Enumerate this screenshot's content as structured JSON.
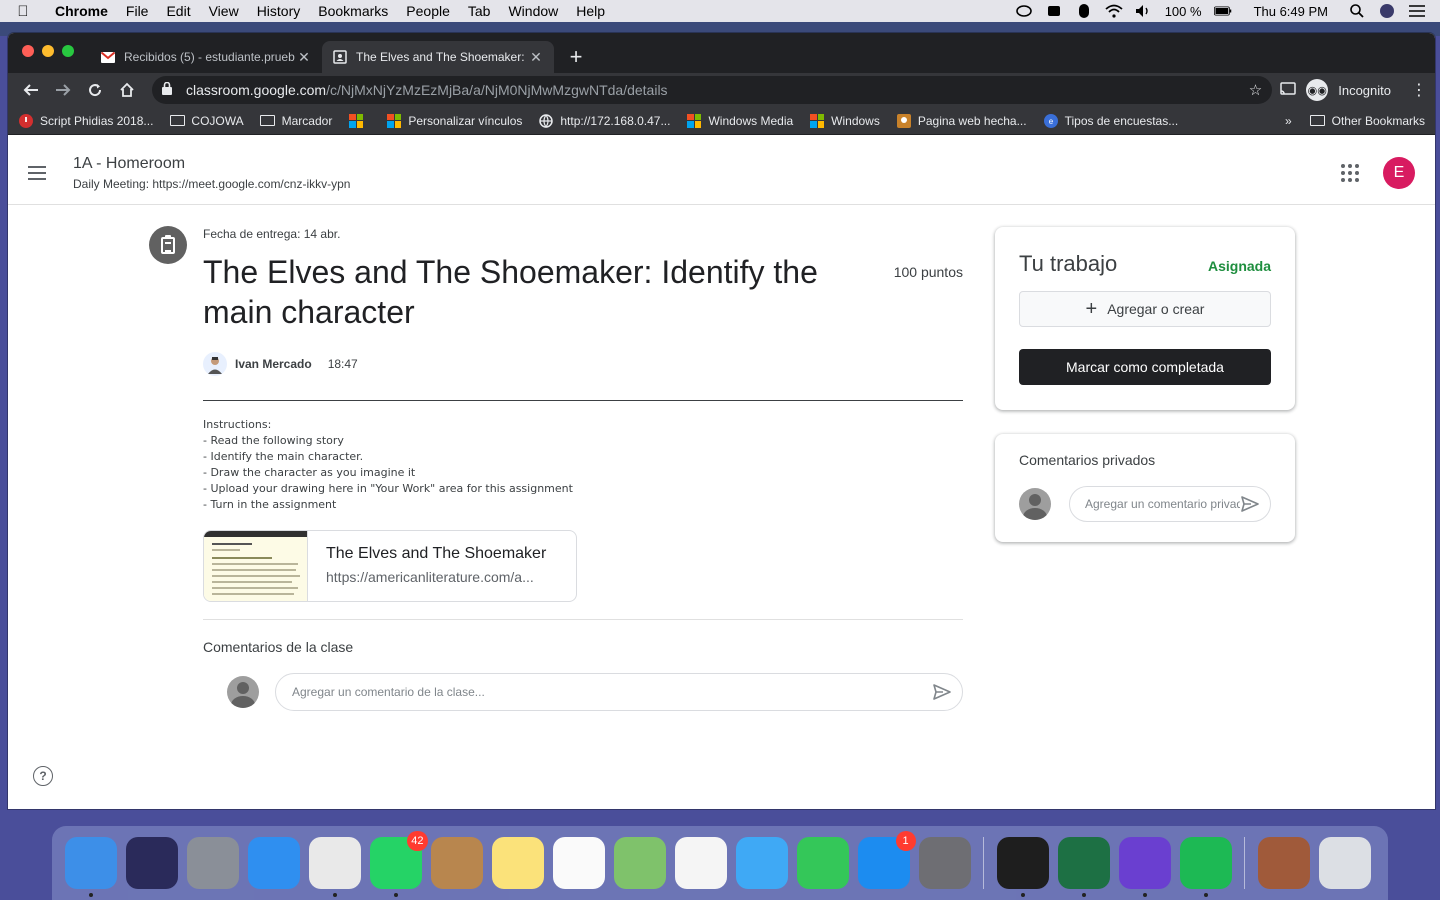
{
  "menubar": {
    "app": "Chrome",
    "items": [
      "File",
      "Edit",
      "View",
      "History",
      "Bookmarks",
      "People",
      "Tab",
      "Window",
      "Help"
    ],
    "battery": "100 %",
    "clock": "Thu 6:49 PM"
  },
  "tabs": [
    {
      "title": "Recibidos (5) - estudiante.prueb",
      "icon": "gmail-icon",
      "active": false
    },
    {
      "title": "The Elves and The Shoemaker: Id",
      "icon": "classroom-icon",
      "active": true
    }
  ],
  "omnibox": {
    "host": "classroom.google.com",
    "path": "/c/NjMxNjYzMzEzMjBa/a/NjM0NjMwMzgwNTda/details"
  },
  "toolbar": {
    "profile_label": "Incognito"
  },
  "bookmarks": {
    "items": [
      {
        "label": "Script Phidias 2018...",
        "icon": "shield-icon"
      },
      {
        "label": "COJOWA",
        "icon": "folder-icon"
      },
      {
        "label": "Marcador",
        "icon": "folder-icon"
      },
      {
        "label": "",
        "icon": "microsoft-icon"
      },
      {
        "label": "Personalizar vínculos",
        "icon": "microsoft-icon"
      },
      {
        "label": "http://172.168.0.47...",
        "icon": "globe-icon"
      },
      {
        "label": "Windows Media",
        "icon": "microsoft-icon"
      },
      {
        "label": "Windows",
        "icon": "microsoft-icon"
      },
      {
        "label": "Pagina web hecha...",
        "icon": "image-icon"
      },
      {
        "label": "Tipos de encuestas...",
        "icon": "survey-icon"
      }
    ],
    "overflow": "»",
    "other": "Other Bookmarks"
  },
  "classroom": {
    "class_name": "1A - Homeroom",
    "class_subtitle": "Daily Meeting: https://meet.google.com/cnz-ikkv-ypn",
    "user_initial": "E",
    "due": "Fecha de entrega: 14 abr.",
    "title": "The Elves and The Shoemaker: Identify the main character",
    "points": "100 puntos",
    "author": "Ivan Mercado",
    "time": "18:47",
    "instructions": [
      "Instructions:",
      "- Read the following story",
      "- Identify the main character.",
      "- Draw the character as you imagine it",
      "- Upload your drawing here in \"Your Work\" area for this assignment",
      "- Turn in the assignment"
    ],
    "attachment": {
      "title": "The Elves and The Shoemaker",
      "url": "https://americanliterature.com/a..."
    },
    "class_comments_title": "Comentarios de la clase",
    "class_comment_placeholder": "Agregar un comentario de la clase...",
    "work": {
      "title": "Tu trabajo",
      "status": "Asignada",
      "add_label": "Agregar o crear",
      "mark_done_label": "Marcar como completada"
    },
    "private_comments_title": "Comentarios privados",
    "private_comment_placeholder": "Agregar un comentario privado..."
  },
  "dock": {
    "items": [
      {
        "name": "finder-icon",
        "color": "#3d8fe8",
        "badge": "",
        "running": true
      },
      {
        "name": "siri-icon",
        "color": "#2a2a5a",
        "badge": "",
        "running": false
      },
      {
        "name": "launchpad-icon",
        "color": "#8a8f98",
        "badge": "",
        "running": false
      },
      {
        "name": "safari-icon",
        "color": "#2f8ff0",
        "badge": "",
        "running": false
      },
      {
        "name": "chrome-icon",
        "color": "#e9e9e9",
        "badge": "",
        "running": true
      },
      {
        "name": "whatsapp-icon",
        "color": "#25d366",
        "badge": "42",
        "running": true
      },
      {
        "name": "contacts-icon",
        "color": "#b8864e",
        "badge": "",
        "running": false
      },
      {
        "name": "notes-icon",
        "color": "#fbe27a",
        "badge": "",
        "running": false
      },
      {
        "name": "reminders-icon",
        "color": "#fafafa",
        "badge": "",
        "running": false
      },
      {
        "name": "maps-icon",
        "color": "#7fc26b",
        "badge": "",
        "running": false
      },
      {
        "name": "photos-icon",
        "color": "#f5f5f5",
        "badge": "",
        "running": false
      },
      {
        "name": "messages-icon",
        "color": "#3fa9f5",
        "badge": "",
        "running": false
      },
      {
        "name": "facetime-icon",
        "color": "#34c759",
        "badge": "",
        "running": false
      },
      {
        "name": "app-store-icon",
        "color": "#1c8cf0",
        "badge": "1",
        "running": false
      },
      {
        "name": "system-preferences-icon",
        "color": "#6e6e73",
        "badge": "",
        "running": false
      },
      {
        "name": "terminal-icon",
        "color": "#1e1e1e",
        "badge": "",
        "running": true
      },
      {
        "name": "excel-icon",
        "color": "#1d7044",
        "badge": "",
        "running": true
      },
      {
        "name": "imovie-icon",
        "color": "#6a3fd0",
        "badge": "",
        "running": true
      },
      {
        "name": "spotify-icon",
        "color": "#1db954",
        "badge": "",
        "running": true
      },
      {
        "name": "picture-icon",
        "color": "#a05a3a",
        "badge": "",
        "running": false
      },
      {
        "name": "trash-icon",
        "color": "#dcdfe4",
        "badge": "",
        "running": false
      }
    ]
  }
}
